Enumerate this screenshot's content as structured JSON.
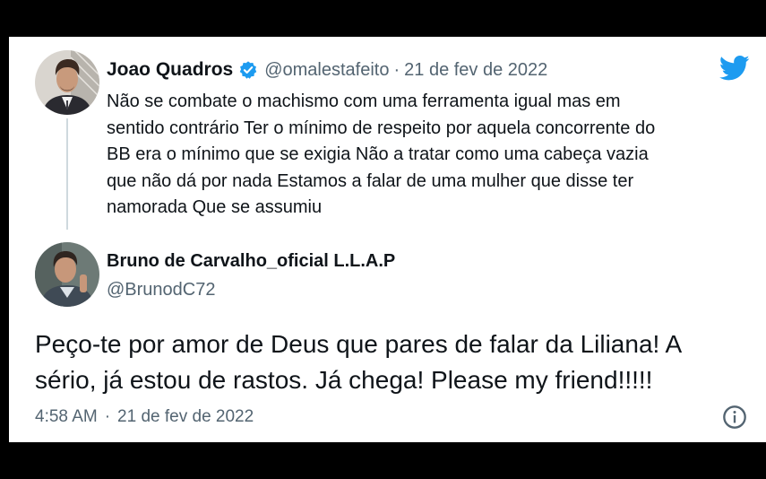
{
  "quoted_tweet": {
    "author_name": "Joao Quadros",
    "handle": "@omalestafeito",
    "separator": "·",
    "date": "21 de fev de 2022",
    "text_lines": [
      "Não se combate o machismo com uma ferramenta igual mas em",
      "sentido contrário Ter o mínimo de respeito por aquela concorrente do",
      "BB era o mínimo que se exigia Não a tratar como uma cabeça vazia",
      "que não dá por nada Estamos a falar de uma mulher que disse ter",
      "namorada Que se assumiu"
    ],
    "verified_icon": "verified-badge-icon"
  },
  "tweet": {
    "author_name": "Bruno de Carvalho_oficial L.L.A.P",
    "handle": "@BrunodC72",
    "text_lines": [
      "Peço-te por amor de Deus que pares de falar da Liliana! A",
      "sério, já estou de rastos. Já chega! Please my friend!!!!!"
    ],
    "time": "4:58 AM",
    "separator": "·",
    "date": "21 de fev de 2022"
  },
  "icons": {
    "logo": "twitter-bird-icon",
    "info": "info-icon"
  },
  "colors": {
    "brand_blue": "#1d9bf0",
    "text_primary": "#0f1419",
    "text_secondary": "#536471",
    "thread_line": "#cfd9de",
    "background": "#000000",
    "card": "#ffffff"
  }
}
